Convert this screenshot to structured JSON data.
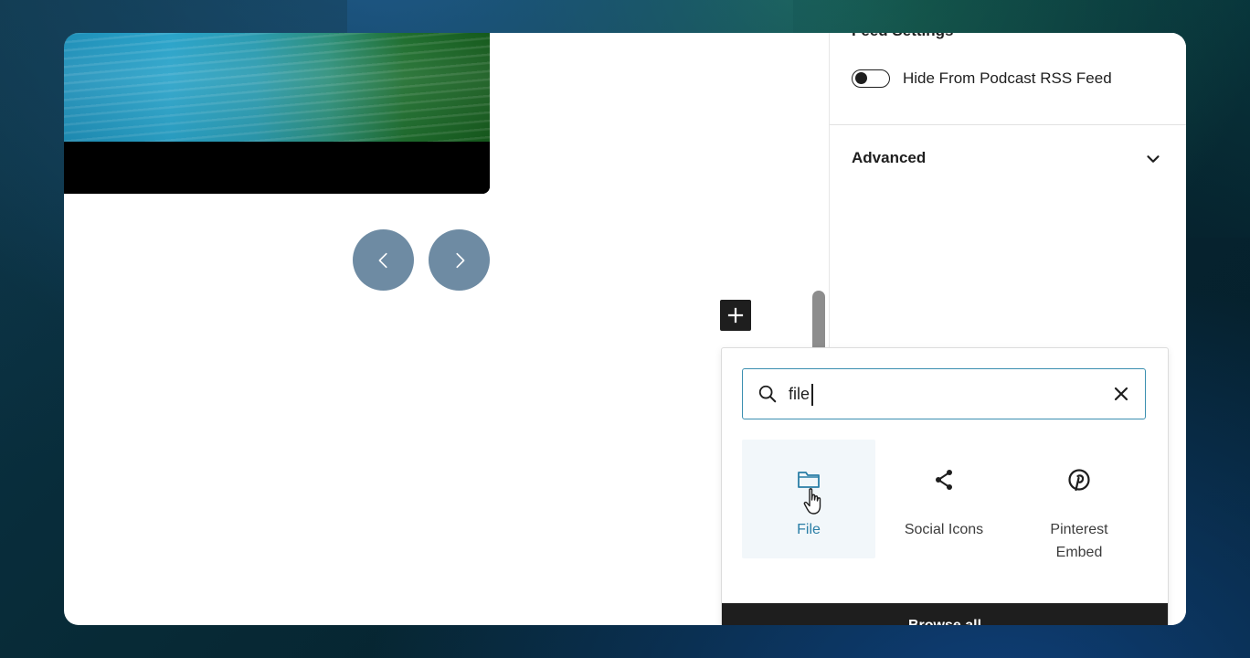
{
  "sidebar": {
    "feed_settings_title": "Feed Settings",
    "hide_from_feed": {
      "label": "Hide From Podcast RSS Feed",
      "enabled": false
    },
    "advanced": {
      "label": "Advanced",
      "icon": "chevron-down-icon"
    }
  },
  "editor": {
    "prev_icon": "chevron-left-icon",
    "next_icon": "chevron-right-icon",
    "add_block_icon": "plus-icon"
  },
  "inserter": {
    "search": {
      "value": "file",
      "placeholder": "Search"
    },
    "results": [
      {
        "label": "File",
        "icon": "folder-icon",
        "active": true
      },
      {
        "label": "Social Icons",
        "icon": "share-icon",
        "active": false
      },
      {
        "label": "Pinterest Embed",
        "icon": "pinterest-icon",
        "active": false
      }
    ],
    "browse_all": "Browse all"
  },
  "colors": {
    "accent": "#3b8fb0",
    "nav_button": "#6e8ba3",
    "dark": "#1e1e1e"
  }
}
